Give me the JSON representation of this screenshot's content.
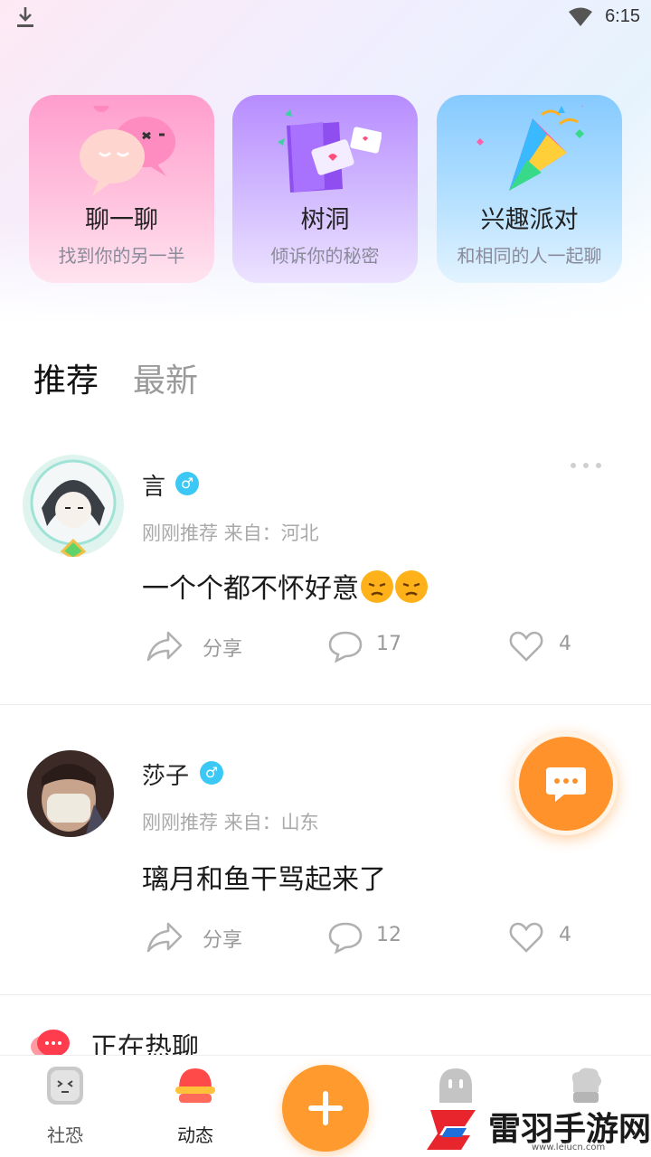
{
  "status_bar": {
    "time": "6:15"
  },
  "feature_cards": [
    {
      "title": "聊一聊",
      "subtitle": "找到你的另一半"
    },
    {
      "title": "树洞",
      "subtitle": "倾诉你的秘密"
    },
    {
      "title": "兴趣派对",
      "subtitle": "和相同的人一起聊"
    }
  ],
  "tabs": {
    "active": "推荐",
    "inactive": "最新"
  },
  "posts": [
    {
      "username": "言",
      "gender": "♂",
      "meta": "刚刚推荐  来自：河北",
      "content": "一个个都不怀好意",
      "share_label": "分享",
      "comments": "17",
      "likes": "4"
    },
    {
      "username": "莎子",
      "gender": "♂",
      "meta": "刚刚推荐  来自：山东",
      "content": "璃月和鱼干骂起来了",
      "share_label": "分享",
      "comments": "12",
      "likes": "4"
    }
  ],
  "hot_section": {
    "title": "正在热聊"
  },
  "bottom_nav": {
    "items": [
      {
        "label": "社恐",
        "icon": "face-block-icon"
      },
      {
        "label": "动态",
        "icon": "red-dome-icon"
      },
      {
        "label": "",
        "icon": "ghost-icon"
      },
      {
        "label": "",
        "icon": "chef-hat-icon"
      }
    ]
  },
  "watermark": {
    "text": "雷羽手游网",
    "url": "www.leiucn.com"
  },
  "colors": {
    "accent": "#ff922b",
    "gender_badge": "#3cc8f5",
    "muted_text": "#a9a9a9"
  }
}
